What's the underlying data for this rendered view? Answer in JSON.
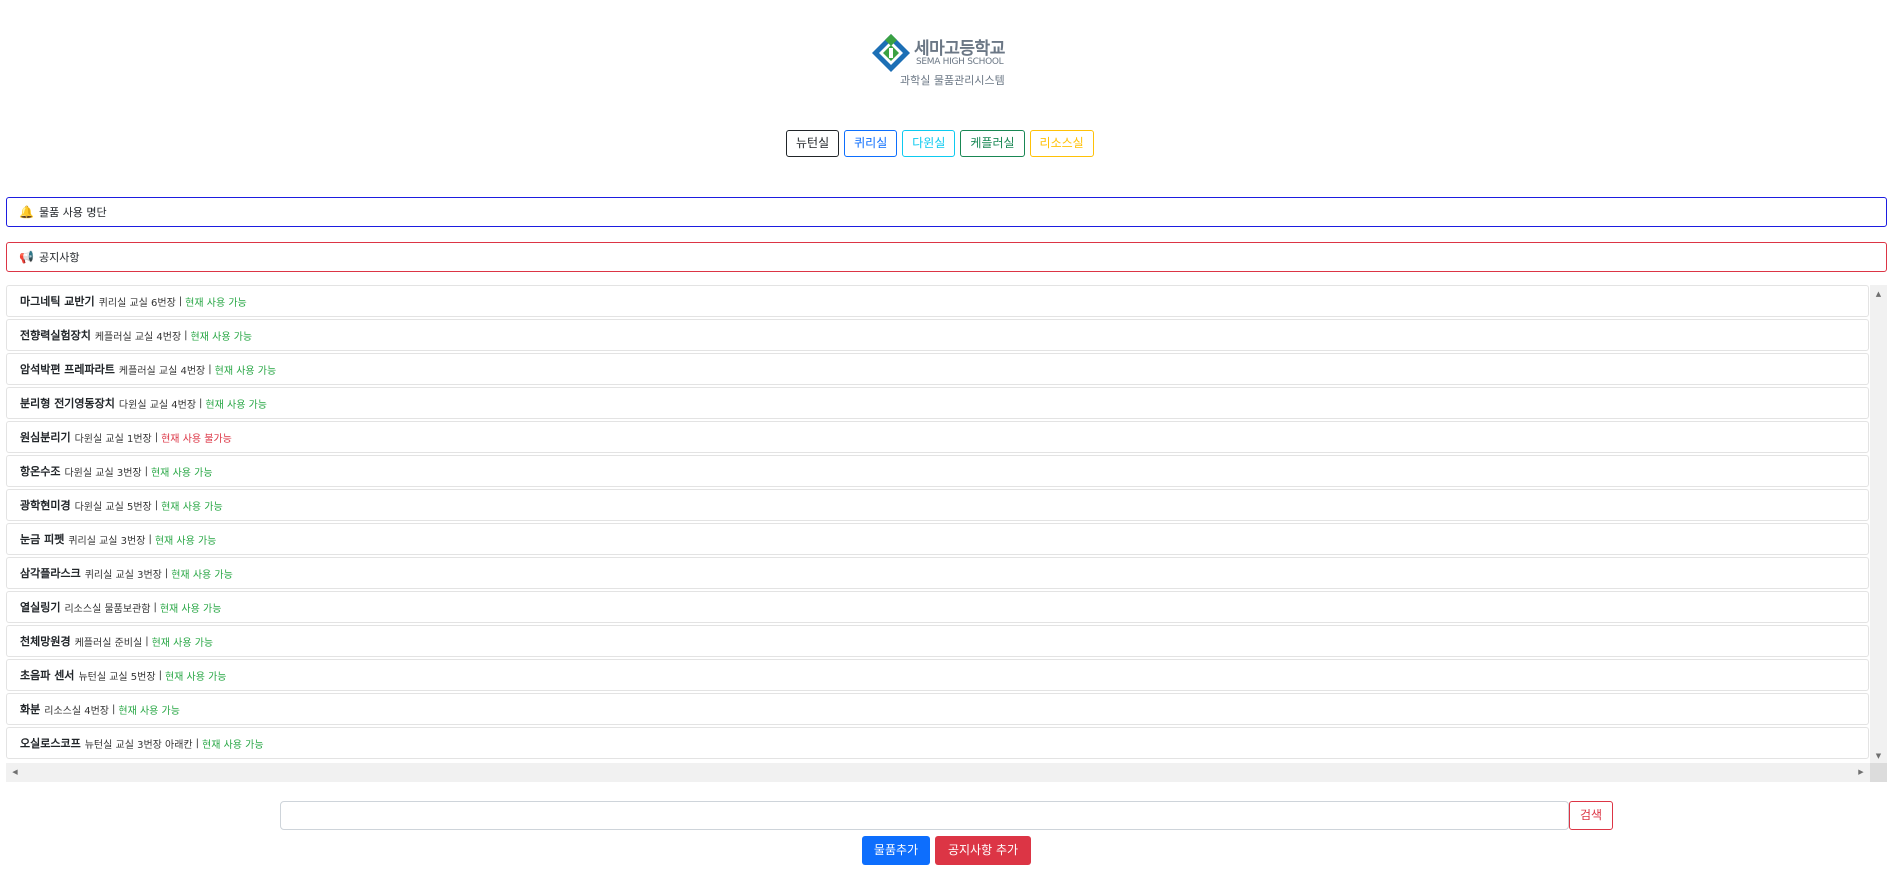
{
  "logo": {
    "school_name": "세마고등학교",
    "school_name_en": "SEMA HIGH SCHOOL",
    "system_name": "과학실 물품관리시스템"
  },
  "tabs": [
    {
      "label": "뉴턴실",
      "color": "#212529"
    },
    {
      "label": "퀴리실",
      "color": "#0d6efd"
    },
    {
      "label": "다윈실",
      "color": "#0dcaf0"
    },
    {
      "label": "케플러실",
      "color": "#198754"
    },
    {
      "label": "리소스실",
      "color": "#ffc107"
    }
  ],
  "usage_bar": {
    "icon": "bell-icon",
    "label": "물품 사용 명단"
  },
  "notice_bar": {
    "icon": "megaphone-icon",
    "label": "공지사항"
  },
  "items": [
    {
      "name": "마그네틱 교반기",
      "location": "퀴리실 교실 6번장",
      "status": "현재 사용 가능",
      "available": true
    },
    {
      "name": "전향력실험장치",
      "location": "케플러실 교실 4번장",
      "status": "현재 사용 가능",
      "available": true
    },
    {
      "name": "암석박편 프레파라트",
      "location": "케플러실 교실 4번장",
      "status": "현재 사용 가능",
      "available": true
    },
    {
      "name": "분리형 전기영동장치",
      "location": "다윈실 교실 4번장",
      "status": "현재 사용 가능",
      "available": true
    },
    {
      "name": "원심분리기",
      "location": "다윈실 교실 1번장",
      "status": "현재 사용 불가능",
      "available": false
    },
    {
      "name": "항온수조",
      "location": "다윈실 교실 3번장",
      "status": "현재 사용 가능",
      "available": true
    },
    {
      "name": "광학현미경",
      "location": "다윈실 교실 5번장",
      "status": "현재 사용 가능",
      "available": true
    },
    {
      "name": "눈금 피펫",
      "location": "퀴리실 교실 3번장",
      "status": "현재 사용 가능",
      "available": true
    },
    {
      "name": "삼각플라스크",
      "location": "퀴리실 교실 3번장",
      "status": "현재 사용 가능",
      "available": true
    },
    {
      "name": "열실링기",
      "location": "리소스실 물품보관함",
      "status": "현재 사용 가능",
      "available": true
    },
    {
      "name": "천체망원경",
      "location": "케플러실 준비실",
      "status": "현재 사용 가능",
      "available": true
    },
    {
      "name": "초음파 센서",
      "location": "뉴턴실 교실 5번장",
      "status": "현재 사용 가능",
      "available": true
    },
    {
      "name": "화분",
      "location": "리소스실 4번장",
      "status": "현재 사용 가능",
      "available": true
    },
    {
      "name": "오실로스코프",
      "location": "뉴턴실 교실 3번장 아래칸",
      "status": "현재 사용 가능",
      "available": true
    }
  ],
  "search": {
    "placeholder": "",
    "value": "",
    "button_label": "검색"
  },
  "actions": {
    "add_item_label": "물품추가",
    "add_notice_label": "공지사항 추가"
  },
  "colors": {
    "available": "#28a745",
    "unavailable": "#dc3545",
    "primary": "#0d6efd",
    "danger": "#dc3545"
  }
}
